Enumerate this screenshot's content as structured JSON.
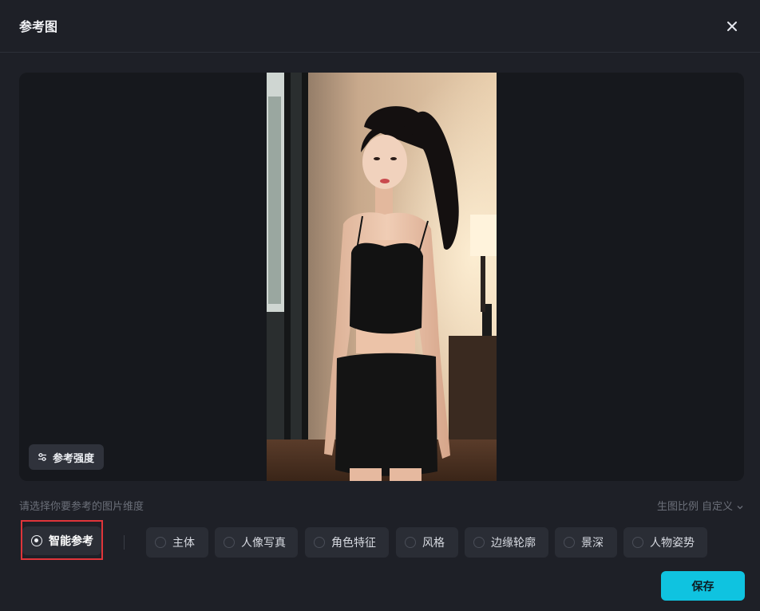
{
  "header": {
    "title": "参考图",
    "close_icon": "close-icon"
  },
  "preview": {
    "strength_label": "参考强度",
    "strength_icon": "sliders-icon"
  },
  "prompt": {
    "text": "请选择你要参考的图片维度",
    "ratio_label": "生图比例",
    "ratio_value": "自定义"
  },
  "options": [
    {
      "label": "智能参考",
      "checked": true
    },
    {
      "label": "主体",
      "checked": false
    },
    {
      "label": "人像写真",
      "checked": false
    },
    {
      "label": "角色特征",
      "checked": false
    },
    {
      "label": "风格",
      "checked": false
    },
    {
      "label": "边缘轮廓",
      "checked": false
    },
    {
      "label": "景深",
      "checked": false
    },
    {
      "label": "人物姿势",
      "checked": false
    }
  ],
  "footer": {
    "save_label": "保存"
  },
  "colors": {
    "accent": "#0fc3e0",
    "highlight_border": "#e0353a",
    "background": "#1e2027"
  }
}
